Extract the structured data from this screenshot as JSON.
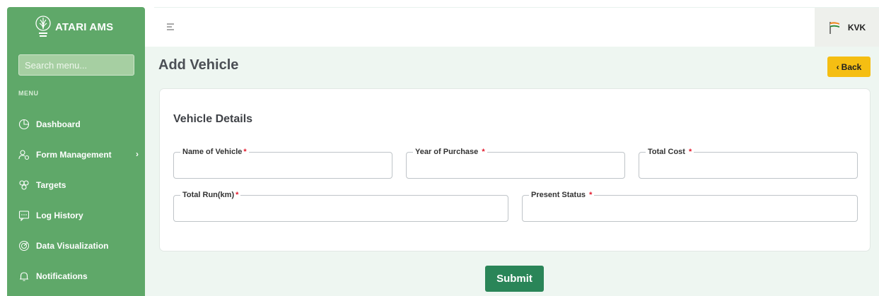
{
  "app": {
    "brand": "ATARI AMS"
  },
  "sidebar": {
    "search_placeholder": "Search menu...",
    "menu_label": "MENU",
    "items": [
      {
        "label": "Dashboard",
        "icon": "pie-chart-icon"
      },
      {
        "label": "Form Management",
        "icon": "users-settings-icon",
        "has_children": true
      },
      {
        "label": "Targets",
        "icon": "gear-cluster-icon"
      },
      {
        "label": "Log History",
        "icon": "chat-log-icon"
      },
      {
        "label": "Data Visualization",
        "icon": "radar-icon"
      },
      {
        "label": "Notifications",
        "icon": "bell-icon"
      }
    ]
  },
  "topbar": {
    "user_label": "KVK",
    "flag_icon": "india-flag-icon"
  },
  "page": {
    "title": "Add Vehicle",
    "back_label": "Back",
    "card_title": "Vehicle Details",
    "fields": [
      {
        "label": "Name of Vehicle",
        "value": ""
      },
      {
        "label": "Year of Purchase ",
        "value": ""
      },
      {
        "label": "Total Cost ",
        "value": ""
      },
      {
        "label": "Total Run(km)",
        "value": ""
      },
      {
        "label": "Present Status ",
        "value": ""
      }
    ],
    "submit_label": "Submit"
  },
  "colors": {
    "sidebar": "#5fa869",
    "back_button": "#f5be12",
    "submit_button": "#2a8558",
    "required_star": "#e2182b",
    "content_bg": "#eef6f1"
  }
}
